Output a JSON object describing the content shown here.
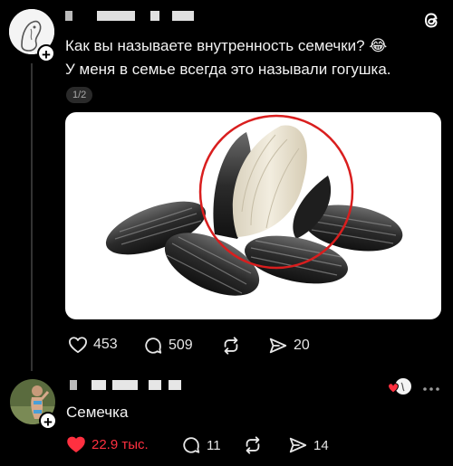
{
  "post": {
    "text_line1": "Как вы называете внутренность семечки? 😂",
    "text_line2": "У меня в семье всегда это называли гогушка.",
    "image_counter": "1/2",
    "likes": "453",
    "comments": "509",
    "reposts": "20"
  },
  "reply": {
    "text": "Семечка",
    "likes": "22.9 тыс.",
    "comments": "11",
    "reposts": "14"
  },
  "icons": {
    "app": "threads-icon",
    "heart": "heart-icon",
    "comment": "comment-icon",
    "repost": "repost-icon",
    "share": "share-icon",
    "more": "more-icon"
  },
  "colors": {
    "background": "#000000",
    "like_active": "#ff3040",
    "highlight_circle": "#d91e1e"
  }
}
